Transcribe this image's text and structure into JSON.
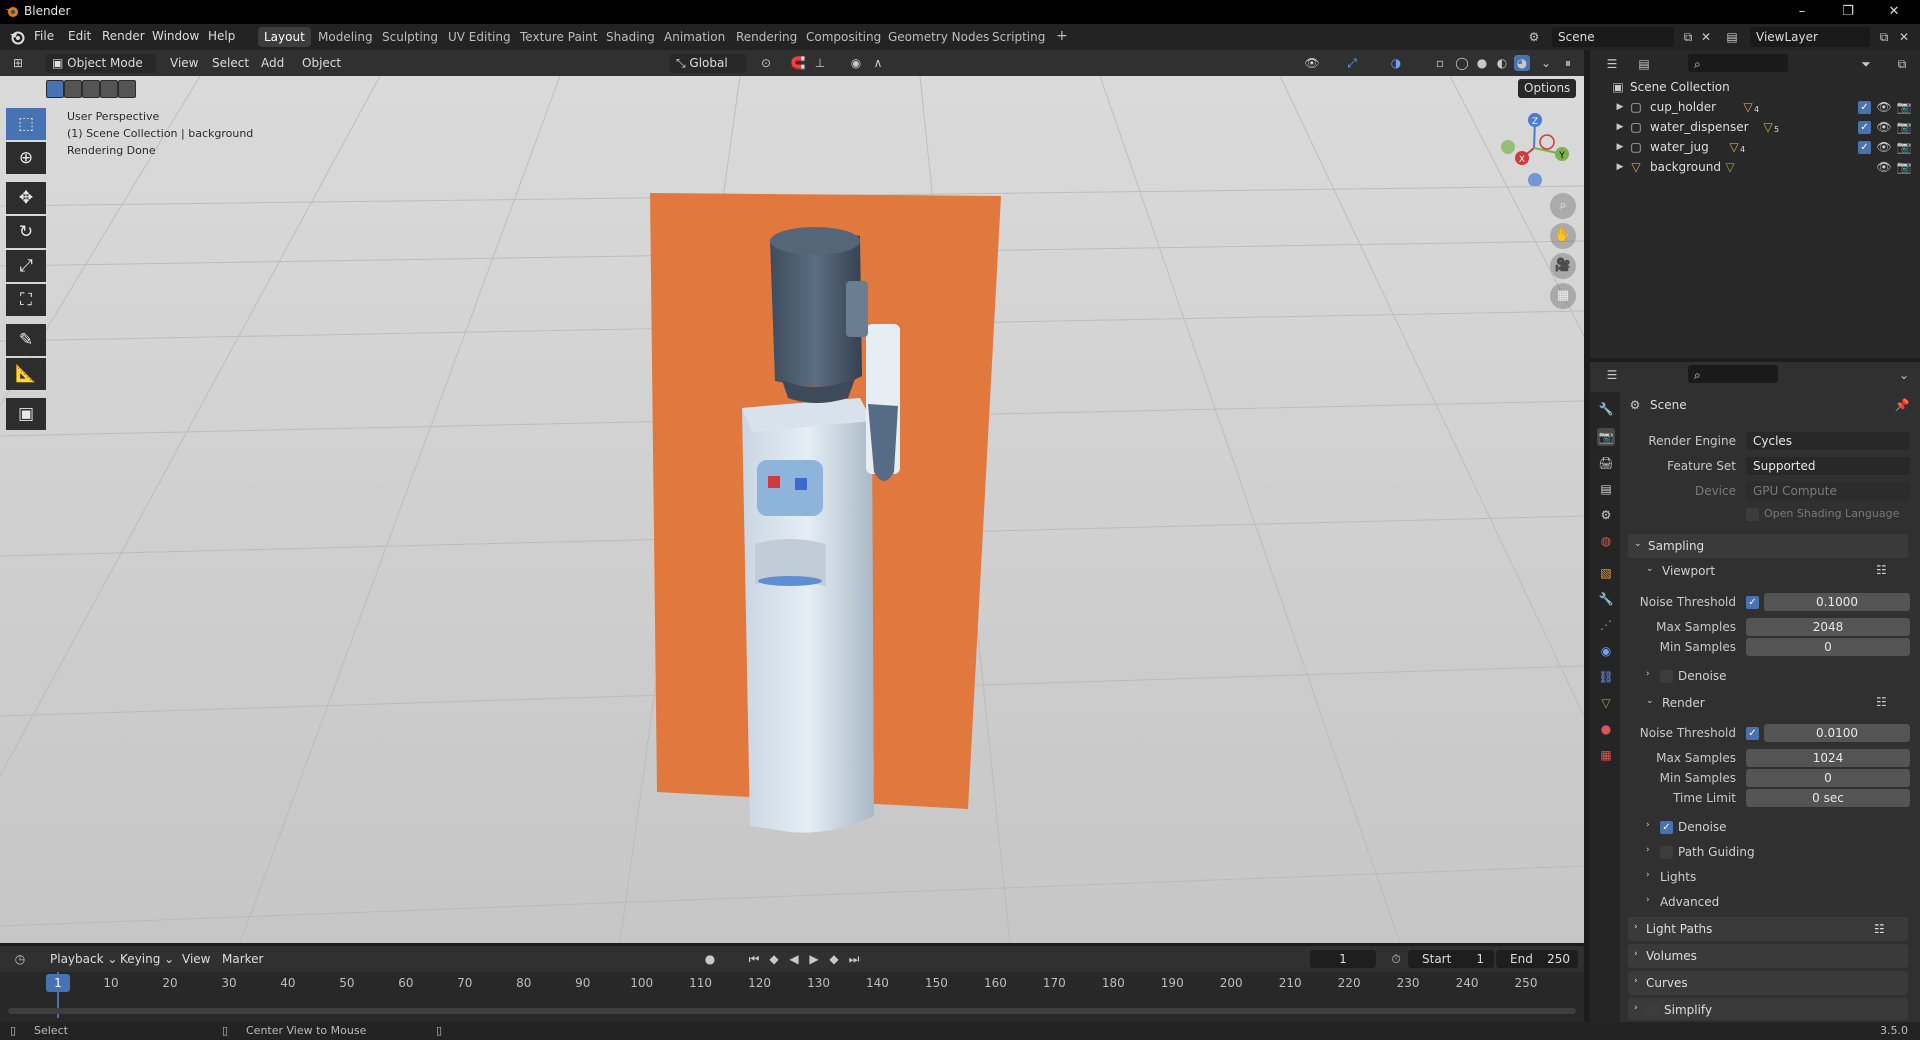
{
  "window": {
    "title": "Blender",
    "controls": [
      "–",
      "❐",
      "✕"
    ]
  },
  "menubar": {
    "menus": [
      "File",
      "Edit",
      "Render",
      "Window",
      "Help"
    ],
    "workspaces": [
      "Layout",
      "Modeling",
      "Sculpting",
      "UV Editing",
      "Texture Paint",
      "Shading",
      "Animation",
      "Rendering",
      "Compositing",
      "Geometry Nodes",
      "Scripting"
    ],
    "active_workspace": "Layout",
    "add_workspace": "+",
    "scene": "Scene",
    "view_layer": "ViewLayer"
  },
  "viewport_header": {
    "mode": "Object Mode",
    "menus": [
      "View",
      "Select",
      "Add",
      "Object"
    ],
    "transform_orientation": "Global",
    "options_label": "Options"
  },
  "viewport": {
    "perspective_label": "User Perspective",
    "collection_label": "(1) Scene Collection | background",
    "status_label": "Rendering Done",
    "gizmo": {
      "z": "Z",
      "x": "X",
      "y": "Y"
    },
    "background_color": "#cfcfcf",
    "backdrop_color": "#e1793f"
  },
  "toolbar": {
    "tools": [
      "select-box",
      "cursor",
      "move",
      "rotate",
      "scale",
      "transform",
      "annotate",
      "measure",
      "add-cube"
    ]
  },
  "outliner": {
    "root": "Scene Collection",
    "items": [
      {
        "name": "cup_holder",
        "badge": "4"
      },
      {
        "name": "water_dispenser",
        "badge": "5"
      },
      {
        "name": "water_jug",
        "badge": "4"
      },
      {
        "name": "background",
        "badge": ""
      }
    ]
  },
  "properties": {
    "context": "Scene",
    "render_engine_label": "Render Engine",
    "render_engine": "Cycles",
    "feature_set_label": "Feature Set",
    "feature_set": "Supported",
    "device_label": "Device",
    "device": "GPU Compute",
    "osl_label": "Open Shading Language",
    "sampling": {
      "label": "Sampling",
      "viewport": {
        "label": "Viewport",
        "noise_threshold_label": "Noise Threshold",
        "noise_threshold": "0.1000",
        "max_samples_label": "Max Samples",
        "max_samples": "2048",
        "min_samples_label": "Min Samples",
        "min_samples": "0",
        "denoise_label": "Denoise"
      },
      "render": {
        "label": "Render",
        "noise_threshold_label": "Noise Threshold",
        "noise_threshold": "0.0100",
        "max_samples_label": "Max Samples",
        "max_samples": "1024",
        "min_samples_label": "Min Samples",
        "min_samples": "0",
        "time_limit_label": "Time Limit",
        "time_limit": "0 sec",
        "denoise_label": "Denoise"
      },
      "path_guiding_label": "Path Guiding",
      "lights_label": "Lights",
      "advanced_label": "Advanced"
    },
    "panels": [
      "Light Paths",
      "Volumes",
      "Curves",
      "Simplify"
    ]
  },
  "timeline": {
    "menus": [
      "Playback",
      "Keying",
      "View",
      "Marker"
    ],
    "current_frame": "1",
    "start_label": "Start",
    "start": "1",
    "end_label": "End",
    "end": "250",
    "ticks": [
      "1",
      "10",
      "20",
      "30",
      "40",
      "50",
      "60",
      "70",
      "80",
      "90",
      "100",
      "110",
      "120",
      "130",
      "140",
      "150",
      "160",
      "170",
      "180",
      "190",
      "200",
      "210",
      "220",
      "230",
      "240",
      "250"
    ]
  },
  "statusbar": {
    "left": "Select",
    "middle": "Center View to Mouse",
    "version": "3.5.0"
  }
}
